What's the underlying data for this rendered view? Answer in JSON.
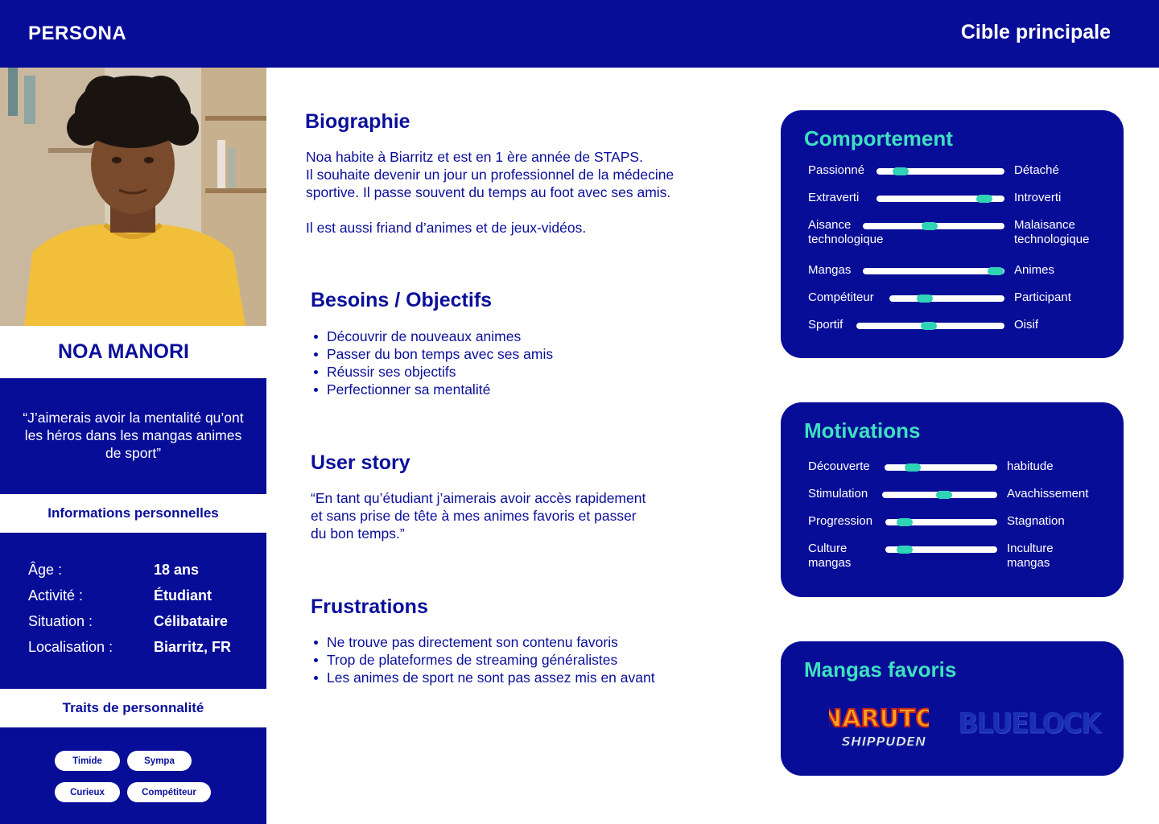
{
  "header": {
    "left_title": "PERSONA",
    "right_title": "Cible principale"
  },
  "persona": {
    "name": "NOA MANORI",
    "quote": "“J’aimerais avoir la mentalité qu’ont les héros dans les mangas animes de sport”"
  },
  "personal_info": {
    "title": "Informations personnelles",
    "rows": [
      {
        "key": "Âge :",
        "value": "18 ans"
      },
      {
        "key": "Activité :",
        "value": "Étudiant"
      },
      {
        "key": "Situation :",
        "value": "Célibataire"
      },
      {
        "key": "Localisation :",
        "value": "Biarritz, FR"
      }
    ]
  },
  "traits": {
    "title": "Traits de personnalité",
    "items": [
      "Timide",
      "Sympa",
      "Curieux",
      "Compétiteur"
    ]
  },
  "biography": {
    "title": "Biographie",
    "lines": [
      "Noa habite à Biarritz et est en 1 ère année de STAPS.",
      "Il souhaite devenir un jour un professionnel de la médecine",
      "sportive. Il passe souvent du temps au foot avec ses amis.",
      "Il est aussi friand d’animes et de jeux-vidéos."
    ]
  },
  "needs": {
    "title": "Besoins  / Objectifs",
    "items": [
      "Découvrir de nouveaux animes",
      "Passer du bon temps avec ses amis",
      "Réussir ses objectifs",
      "Perfectionner sa mentalité"
    ]
  },
  "user_story": {
    "title": "User story",
    "lines": [
      "“En tant qu’étudiant j’aimerais avoir accès rapidement",
      "et sans prise de tête à mes animes favoris et passer",
      "du bon temps.”"
    ]
  },
  "frustrations": {
    "title": "Frustrations",
    "items": [
      "Ne trouve pas directement son contenu favoris",
      "Trop de plateformes de streaming généralistes",
      "Les animes de sport ne sont pas assez mis en avant"
    ]
  },
  "behavior": {
    "title": "Comportement",
    "sliders": [
      {
        "left": "Passionné",
        "right": "Détaché",
        "value": 0.19
      },
      {
        "left": "Extraverti",
        "right": "Introverti",
        "value": 0.84
      },
      {
        "left": "Aisance\ntechnologique",
        "right": "Malaisance\ntechnologique",
        "value": 0.47
      },
      {
        "left": "Mangas",
        "right": "Animes",
        "value": 0.94
      },
      {
        "left": "Compétiteur",
        "right": "Participant",
        "value": 0.31
      },
      {
        "left": "Sportif",
        "right": "Oisif",
        "value": 0.49
      }
    ]
  },
  "motivations": {
    "title": "Motivations",
    "sliders": [
      {
        "left": "Découverte",
        "right": "habitude",
        "value": 0.25
      },
      {
        "left": "Stimulation",
        "right": "Avachissement",
        "value": 0.54
      },
      {
        "left": "Progression",
        "right": "Stagnation",
        "value": 0.17
      },
      {
        "left": "Culture\nmangas",
        "right": "Inculture\nmangas",
        "value": 0.17
      }
    ]
  },
  "favorites": {
    "title": "Mangas favoris",
    "logos": [
      "NARUTO",
      "SHIPPUDEN",
      "BLUELOCK"
    ]
  },
  "colors": {
    "navy": "#080d98",
    "accent": "#2fd3b5",
    "white": "#ffffff"
  }
}
